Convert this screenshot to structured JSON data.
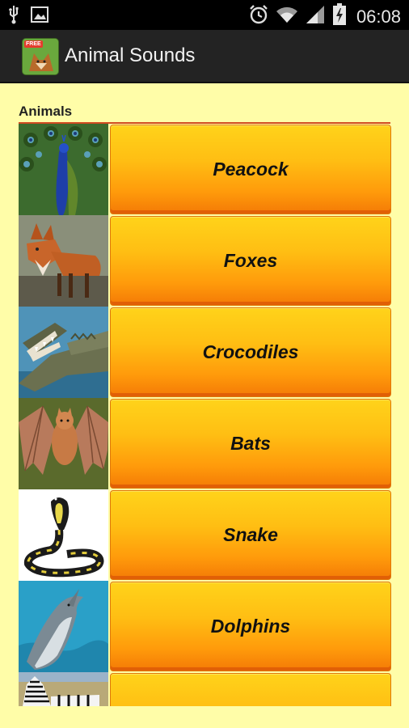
{
  "status_bar": {
    "time": "06:08",
    "icons": [
      "usb-icon",
      "image-icon",
      "alarm-icon",
      "wifi-icon",
      "signal-icon",
      "battery-charging-icon"
    ]
  },
  "action_bar": {
    "title": "Animal Sounds",
    "icon_badge": "FREE",
    "icon": "fox-app-icon"
  },
  "section": {
    "label": "Animals"
  },
  "animals": [
    {
      "name": "Peacock",
      "thumb": "peacock-photo"
    },
    {
      "name": "Foxes",
      "thumb": "fox-photo"
    },
    {
      "name": "Crocodiles",
      "thumb": "crocodile-photo"
    },
    {
      "name": "Bats",
      "thumb": "bat-photo"
    },
    {
      "name": "Snake",
      "thumb": "cobra-photo"
    },
    {
      "name": "Dolphins",
      "thumb": "dolphin-photo"
    },
    {
      "name": "",
      "thumb": "zebra-photo"
    }
  ],
  "colors": {
    "background": "#fffda8",
    "button_top": "#ffd31a",
    "button_bottom": "#f47a06",
    "divider": "#d14a20",
    "action_bar": "#232323"
  }
}
